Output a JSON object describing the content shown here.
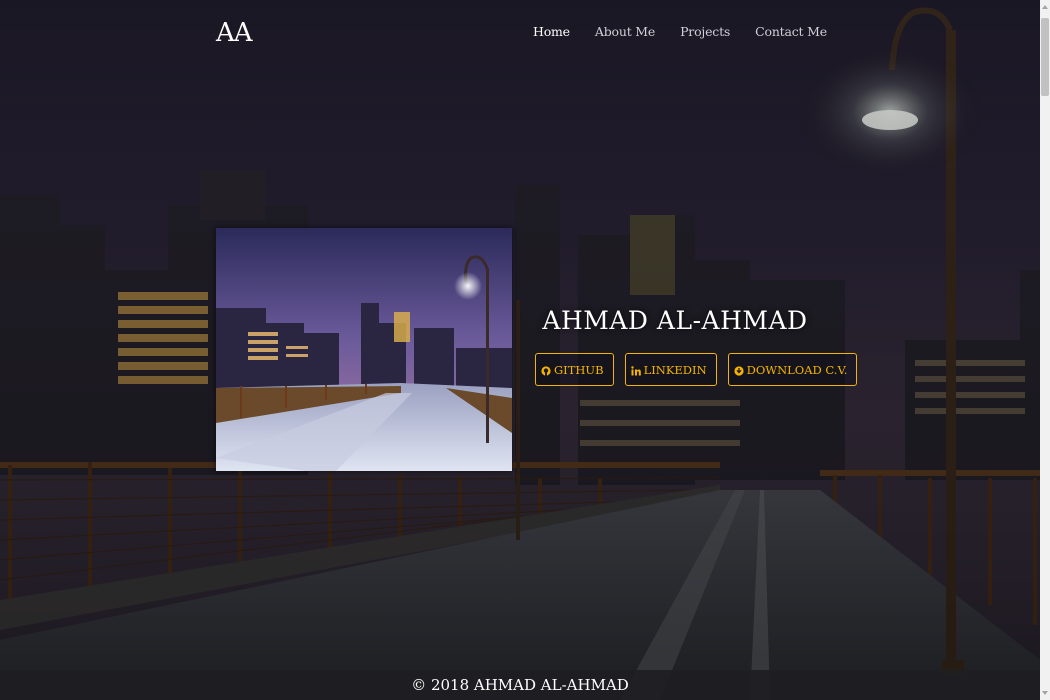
{
  "brand": {
    "logo": "AA"
  },
  "nav": {
    "items": [
      {
        "label": "Home",
        "active": true
      },
      {
        "label": "About Me",
        "active": false
      },
      {
        "label": "Projects",
        "active": false
      },
      {
        "label": "Contact Me",
        "active": false
      }
    ]
  },
  "hero": {
    "name": "AHMAD AL-AHMAD",
    "buttons": [
      {
        "label": "GITHUB",
        "icon": "github-icon"
      },
      {
        "label": "LINKEDIN",
        "icon": "linkedin-icon"
      },
      {
        "label": "DOWNLOAD C.V.",
        "icon": "download-icon"
      }
    ]
  },
  "footer": {
    "text": "© 2018 AHMAD AL-AHMAD"
  },
  "colors": {
    "accent": "#f5b400",
    "footer_bg": "#1e1e23",
    "text": "#ffffff"
  }
}
